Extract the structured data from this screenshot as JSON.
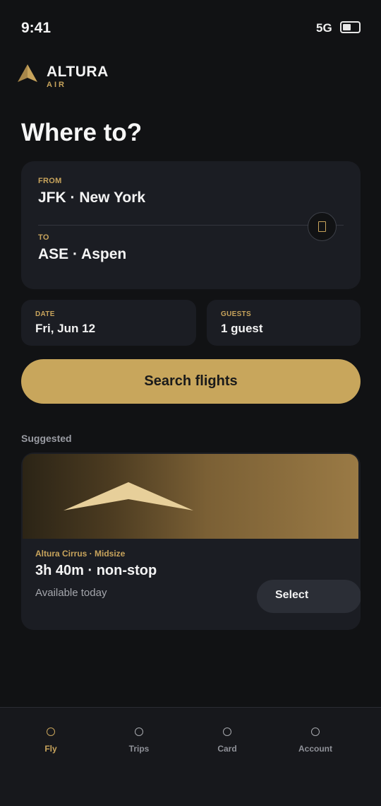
{
  "status": {
    "time": "9:41",
    "signal": "5G",
    "battery_level": 0.5
  },
  "brand": {
    "name": "ALTURA",
    "sub": "AIR",
    "accent_color": "#c8a45c"
  },
  "page_title": "Where to?",
  "route": {
    "from_label": "FROM",
    "from_value": "JFK · New York",
    "to_label": "TO",
    "to_value": "ASE · Aspen",
    "swap_icon": "swap-icon"
  },
  "date": {
    "label": "DATE",
    "value": "Fri, Jun 12"
  },
  "guests": {
    "label": "GUESTS",
    "value": "1 guest"
  },
  "search_button": "Search flights",
  "suggested": {
    "title": "Suggested",
    "model": "Altura Cirrus · Midsize",
    "duration": "3h 40m · non-stop",
    "availability": "Available today",
    "select_label": "Select"
  },
  "nav": {
    "items": [
      {
        "label": "Fly",
        "icon": "fly-icon",
        "active": true
      },
      {
        "label": "Trips",
        "icon": "trips-icon",
        "active": false
      },
      {
        "label": "Card",
        "icon": "card-icon",
        "active": false
      },
      {
        "label": "Account",
        "icon": "account-icon",
        "active": false
      }
    ]
  }
}
